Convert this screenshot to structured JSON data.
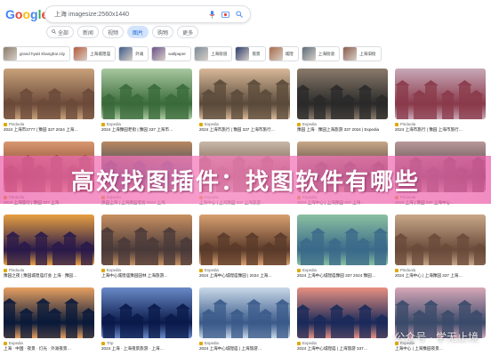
{
  "logo": {
    "letters": [
      "G",
      "o",
      "o",
      "g",
      "l",
      "e"
    ],
    "colors": [
      "#4285f4",
      "#ea4335",
      "#fbbc05",
      "#4285f4",
      "#34a853",
      "#ea4335"
    ]
  },
  "search": {
    "query": "上海 imagesize:2560x1440",
    "icons": [
      "mic-icon",
      "camera-icon",
      "search-icon"
    ]
  },
  "tabs": [
    {
      "label": "全部",
      "icon": "search-icon",
      "active": false
    },
    {
      "label": "新闻",
      "active": false
    },
    {
      "label": "视频",
      "active": false
    },
    {
      "label": "图片",
      "active": true
    },
    {
      "label": "购物",
      "active": false
    },
    {
      "label": "更多",
      "active": false
    }
  ],
  "chips": [
    {
      "label": "grand hyatt shanghai city",
      "color": "#8a7b6b"
    },
    {
      "label": "上海城隍庙",
      "color": "#b55a3a"
    },
    {
      "label": "外滩",
      "color": "#3c5a8a"
    },
    {
      "label": "wallpaper",
      "color": "#6a4f8a"
    },
    {
      "label": "上海街道",
      "color": "#7a8a9a"
    },
    {
      "label": "夜景",
      "color": "#2a3a6a"
    },
    {
      "label": "城隍",
      "color": "#a86a4a"
    },
    {
      "label": "上海街道",
      "color": "#5a6a7a"
    },
    {
      "label": "上海旧街",
      "color": "#8a5a4a"
    }
  ],
  "rows": [
    [
      {
        "source": "Pinduola",
        "title": "2024 上海市3777 | 豫园 337 2024 上海…",
        "c1": "#6b4a3a",
        "c2": "#c9a27a"
      },
      {
        "source": "Expedia",
        "title": "2024 上海豫园老街 | 豫园 337 上海市…",
        "c1": "#3a6a3a",
        "c2": "#a8c8a0"
      },
      {
        "source": "Expedia",
        "title": "2024 上海市旅行 | 豫园 337 上海市旅行…",
        "c1": "#5a4a3a",
        "c2": "#d8b898"
      },
      {
        "source": "Expedia",
        "title": "豫园 上海 · 豫园上海旅游 337 2024 | Expedia",
        "c1": "#2a2a2a",
        "c2": "#8a7a6a"
      },
      {
        "source": "Pinduola",
        "title": "2024 上海市旅行 | 豫园 上海市旅行…",
        "c1": "#8a3a4a",
        "c2": "#c8a8b8"
      }
    ],
    [
      {
        "source": "Pinduola",
        "title": "2024 上海旅行 | 豫园 337 上海…",
        "c1": "#7a3a2a",
        "c2": "#d89870"
      },
      {
        "source": "Expedia",
        "title": "豫园上海 | 上海豫园老街 2024 上海…",
        "c1": "#2a3a5a",
        "c2": "#b88860"
      },
      {
        "source": "Expedia",
        "title": "上海中心 | 上海豫园 337 上海旅游…",
        "c1": "#6a4a3a",
        "c2": "#c8b8a8"
      },
      {
        "source": "Expedia",
        "title": "2024 上海中心 | 上海豫园 337 上海…",
        "c1": "#3a2a2a",
        "c2": "#c8a888"
      },
      {
        "source": "Pinduola",
        "title": "2024 上海 | 豫园 337 上海中心…",
        "c1": "#4a3a3a",
        "c2": "#b8989a"
      }
    ],
    [
      {
        "source": "Pinduola",
        "title": "豫园之夜 | 豫园城隍庙灯会 上海 · 豫园…",
        "c1": "#2a1a4a",
        "c2": "#e8a040"
      },
      {
        "source": "Expedia",
        "title": "上海中心城隍庙豫园园林 上海旅游…",
        "c1": "#4a3a3a",
        "c2": "#c89060"
      },
      {
        "source": "Expedia",
        "title": "2024 上海中心城隍庙豫园 | 2024 上海…",
        "c1": "#5a3a2a",
        "c2": "#d8a070"
      },
      {
        "source": "Expedia",
        "title": "2024 上海中心城隍庙豫园 337 2024 豫园…",
        "c1": "#3a6a8a",
        "c2": "#8ac0a0"
      },
      {
        "source": "Pinduola",
        "title": "2024 上海中心 | 上海豫园 337 上海…",
        "c1": "#6a4a3a",
        "c2": "#c8a888"
      }
    ],
    [
      {
        "source": "Expedia",
        "title": "上海 · 中国 · 夜景 · 灯光 · 外滩夜景…",
        "c1": "#0a1a3a",
        "c2": "#e8a060"
      },
      {
        "source": "Trip",
        "title": "2024 上海 · 上海夜景旅游 · 上海…",
        "c1": "#0a1a4a",
        "c2": "#6a8ac8"
      },
      {
        "source": "Expedia",
        "title": "2024 上海中心城隍庙 | 上海旅游…",
        "c1": "#3a5a8a",
        "c2": "#c8d8e8"
      },
      {
        "source": "Expedia",
        "title": "2024 上海中心城隍庙 | 上海旅游 337…",
        "c1": "#1a2a5a",
        "c2": "#e89080"
      },
      {
        "source": "Expedia",
        "title": "上海中心 | 上海豫园夜景…",
        "c1": "#3a4a6a",
        "c2": "#d8a8b8"
      }
    ]
  ],
  "banner": {
    "text": "高效找图插件：找图软件有哪些"
  },
  "watermark": {
    "text": "公众号 · 学无止境"
  }
}
